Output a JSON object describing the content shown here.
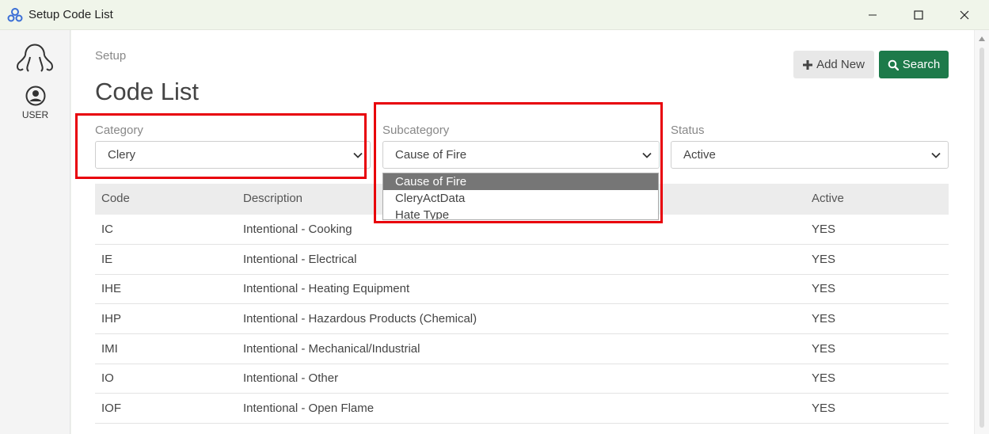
{
  "window": {
    "title": "Setup Code List"
  },
  "rail": {
    "user_label": "USER"
  },
  "header": {
    "breadcrumb": "Setup",
    "title": "Code List",
    "add_label": "Add New",
    "search_label": "Search"
  },
  "filters": {
    "category": {
      "label": "Category",
      "value": "Clery"
    },
    "subcategory": {
      "label": "Subcategory",
      "value": "Cause of Fire",
      "options": [
        "Cause of Fire",
        "CleryActData",
        "Hate Type"
      ]
    },
    "status": {
      "label": "Status",
      "value": "Active"
    }
  },
  "table": {
    "headers": [
      "Code",
      "Description",
      "Active"
    ],
    "rows": [
      [
        "IC",
        "Intentional - Cooking",
        "YES"
      ],
      [
        "IE",
        "Intentional - Electrical",
        "YES"
      ],
      [
        "IHE",
        "Intentional - Heating Equipment",
        "YES"
      ],
      [
        "IHP",
        "Intentional - Hazardous Products (Chemical)",
        "YES"
      ],
      [
        "IMI",
        "Intentional - Mechanical/Industrial",
        "YES"
      ],
      [
        "IO",
        "Intentional - Other",
        "YES"
      ],
      [
        "IOF",
        "Intentional - Open Flame",
        "YES"
      ]
    ]
  },
  "colors": {
    "accent": "#1d7a4a",
    "highlight": "#e8000a"
  }
}
